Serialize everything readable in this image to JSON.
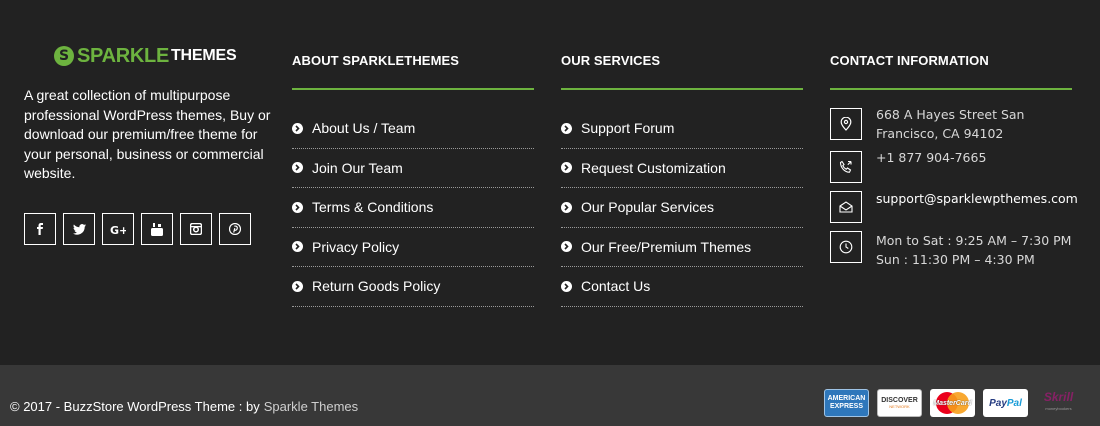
{
  "brand": {
    "mark": "S",
    "word1": "SPARKLE",
    "word2": "THEMES"
  },
  "about": {
    "text": "A great collection of multipurpose professional WordPress themes, Buy or download our premium/free theme for your personal, business or commercial website."
  },
  "socials": [
    {
      "icon": "facebook-icon",
      "glyph": "f"
    },
    {
      "icon": "twitter-icon",
      "glyph": "t"
    },
    {
      "icon": "google-plus-icon",
      "glyph": "G+"
    },
    {
      "icon": "youtube-icon",
      "glyph": "yt"
    },
    {
      "icon": "instagram-icon",
      "glyph": "ig"
    },
    {
      "icon": "pinterest-icon",
      "glyph": "p"
    }
  ],
  "columns": {
    "about": {
      "title": "ABOUT SPARKLETHEMES",
      "links": [
        "About Us / Team",
        "Join Our Team",
        "Terms & Conditions",
        "Privacy Policy",
        "Return Goods Policy"
      ]
    },
    "services": {
      "title": "OUR SERVICES",
      "links": [
        "Support Forum",
        "Request Customization",
        "Our Popular Services",
        "Our Free/Premium Themes",
        "Contact Us"
      ]
    },
    "contact": {
      "title": "CONTACT INFORMATION",
      "address_line1": "668 A Hayes Street San",
      "address_line2": "Francisco, CA 94102",
      "phone": "+1 877 904-7665",
      "email": "support@sparklewpthemes.com",
      "hours_line1": "Mon to Sat : 9:25 AM – 7:30 PM",
      "hours_line2": "Sun : 11:30 PM – 4:30 PM"
    }
  },
  "bottom": {
    "copyright": "© 2017 - BuzzStore WordPress Theme : by",
    "author": "Sparkle Themes",
    "payments": {
      "amex": "AMERICAN EXPRESS",
      "discover": "DISCOVER",
      "discover_sub": "NETWORK",
      "mastercard": "MasterCard",
      "paypal_1": "Pay",
      "paypal_2": "Pal",
      "skrill": "Skrill",
      "skrill_sub": "moneybookers"
    }
  },
  "colors": {
    "accent": "#6db33f",
    "bg_top": "#222222",
    "bg_bottom": "#383838"
  }
}
